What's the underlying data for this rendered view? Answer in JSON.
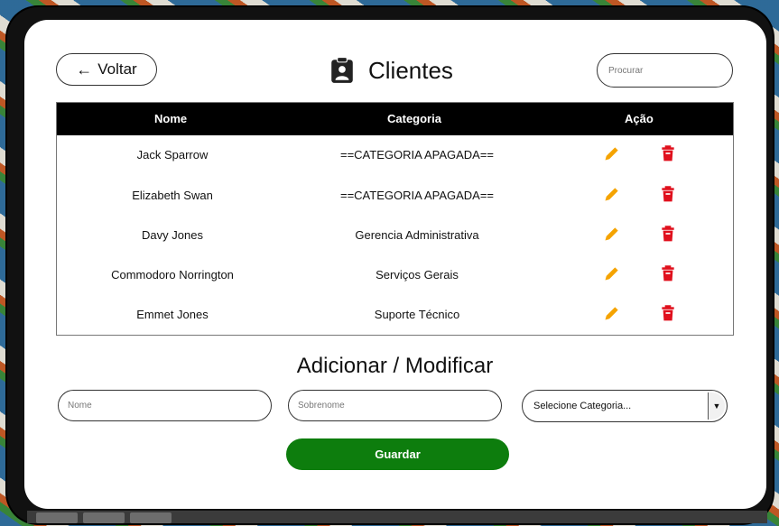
{
  "header": {
    "back_label": "Voltar",
    "title": "Clientes",
    "search_placeholder": "Procurar"
  },
  "table": {
    "columns": [
      "Nome",
      "Categoria",
      "Ação"
    ],
    "rows": [
      {
        "nome": "Jack Sparrow",
        "categoria": "==CATEGORIA APAGADA=="
      },
      {
        "nome": "Elizabeth Swan",
        "categoria": "==CATEGORIA APAGADA=="
      },
      {
        "nome": "Davy Jones",
        "categoria": "Gerencia Administrativa"
      },
      {
        "nome": "Commodoro Norrington",
        "categoria": "Serviços Gerais"
      },
      {
        "nome": "Emmet Jones",
        "categoria": "Suporte Técnico"
      }
    ],
    "icons": {
      "edit": "pencil-icon",
      "delete": "trash-icon"
    }
  },
  "form": {
    "title": "Adicionar / Modificar",
    "nome_placeholder": "Nome",
    "sobrenome_placeholder": "Sobrenome",
    "categoria_selected": "Selecione Categoria...",
    "save_label": "Guardar"
  },
  "colors": {
    "header_bg": "#000000",
    "edit_icon": "#f5a300",
    "delete_icon": "#e0101d",
    "save_button": "#0d7d0d"
  }
}
